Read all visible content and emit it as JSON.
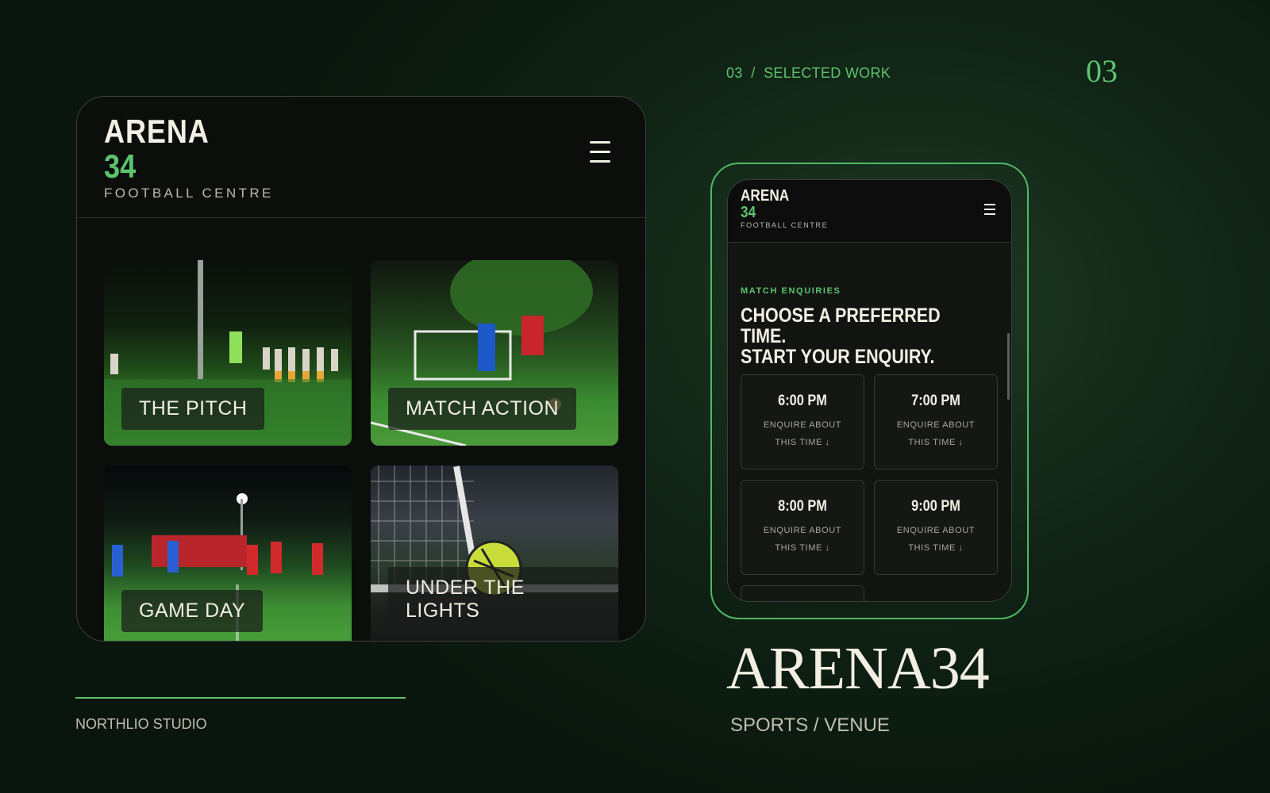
{
  "tablet": {
    "logo": {
      "line1": "ARENA",
      "line2": "34",
      "tagline": "FOOTBALL CENTRE"
    },
    "tiles": [
      {
        "label": "THE PITCH"
      },
      {
        "label": "MATCH ACTION"
      },
      {
        "label": "GAME DAY"
      },
      {
        "label": "UNDER THE LIGHTS"
      }
    ]
  },
  "eyebrow": "03  /  SELECTED WORK",
  "page_number": "03",
  "phone": {
    "logo": {
      "line1": "ARENA",
      "line2": "34",
      "tagline": "FOOTBALL CENTRE"
    },
    "kicker": "MATCH ENQUIRIES",
    "title_line1": "CHOOSE A PREFERRED TIME.",
    "title_line2": "START YOUR ENQUIRY.",
    "slots": [
      {
        "time": "6:00 PM",
        "cta": "ENQUIRE ABOUT THIS TIME ↓"
      },
      {
        "time": "7:00 PM",
        "cta": "ENQUIRE ABOUT THIS TIME ↓"
      },
      {
        "time": "8:00 PM",
        "cta": "ENQUIRE ABOUT THIS TIME ↓"
      },
      {
        "time": "9:00 PM",
        "cta": "ENQUIRE ABOUT THIS TIME ↓"
      }
    ]
  },
  "studio": "NORTHLIO STUDIO",
  "project_title": "ARENA34",
  "project_category": "SPORTS / VENUE",
  "colors": {
    "accent": "#5cc36e",
    "background": "#0f2114",
    "text": "#f3efe4"
  }
}
